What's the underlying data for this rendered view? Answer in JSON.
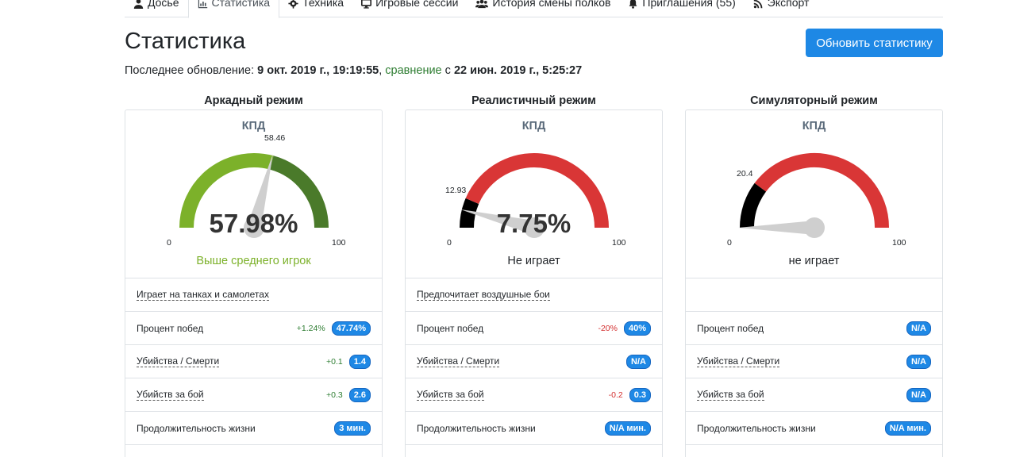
{
  "tabs": [
    {
      "label": "Досье",
      "icon": "user-icon",
      "active": false
    },
    {
      "label": "Статистика",
      "icon": "chart-icon",
      "active": true
    },
    {
      "label": "Техника",
      "icon": "gear-icon",
      "active": false
    },
    {
      "label": "Игровые сессии",
      "icon": "monitor-icon",
      "active": false
    },
    {
      "label": "История смены полков",
      "icon": "users-icon",
      "active": false
    },
    {
      "label": "Приглашения (55)",
      "icon": "bell-icon",
      "active": false
    },
    {
      "label": "Экспорт",
      "icon": "rss-icon",
      "active": false
    }
  ],
  "header": {
    "title": "Статистика",
    "refresh_label": "Обновить статистику"
  },
  "update": {
    "prefix": "Последнее обновление: ",
    "date": "9 окт. 2019 г., 19:19:55",
    "comma": ", ",
    "compare": "сравнение",
    "with": " с ",
    "compare_date": "22 июн. 2019 г., 5:25:27"
  },
  "colors": {
    "accent": "#1e88e5",
    "gauge_green_light": "#7cb12a",
    "gauge_green_dark": "#4a7a2a",
    "gauge_red": "#d93636",
    "gauge_black": "#000000",
    "positive": "#2e7d32",
    "negative": "#d32f2f"
  },
  "modes": [
    {
      "title": "Аркадный режим",
      "kpd_label": "КПД",
      "gauge": {
        "min_label": "0",
        "max_label": "100",
        "marker_label": "58.46",
        "marker": 58.46,
        "value": 57.98,
        "value_label": "57.98%",
        "fill_color": "#7cb12a",
        "rest_color": "#4a7a2a"
      },
      "status": "Выше среднего игрок",
      "status_color": "#7cb12a",
      "preference": "Играет на танках и самолетах",
      "rows": [
        {
          "label": "Процент побед",
          "dotted": false,
          "delta": "+1.24%",
          "delta_sign": "pos",
          "value": "47.74%"
        },
        {
          "label": "Убийства / Смерти",
          "dotted": true,
          "delta": "+0.1",
          "delta_sign": "pos",
          "value": "1.4"
        },
        {
          "label": "Убийств за бой",
          "dotted": true,
          "delta": "+0.3",
          "delta_sign": "pos",
          "value": "2.6"
        },
        {
          "label": "Продолжительность жизни",
          "dotted": false,
          "delta": "",
          "delta_sign": "",
          "value": "3 мин."
        }
      ]
    },
    {
      "title": "Реалистичный режим",
      "kpd_label": "КПД",
      "gauge": {
        "min_label": "0",
        "max_label": "100",
        "marker_label": "12.93",
        "marker": 12.93,
        "value": 7.75,
        "value_label": "7.75%",
        "fill_color": "#000000",
        "rest_color": "#d93636"
      },
      "status": "Не играет",
      "status_color": "#212529",
      "preference": "Предпочитает воздушные бои",
      "rows": [
        {
          "label": "Процент побед",
          "dotted": false,
          "delta": "-20%",
          "delta_sign": "neg",
          "value": "40%"
        },
        {
          "label": "Убийства / Смерти",
          "dotted": true,
          "delta": "",
          "delta_sign": "",
          "value": "N/A"
        },
        {
          "label": "Убийств за бой",
          "dotted": true,
          "delta": "-0.2",
          "delta_sign": "neg",
          "value": "0.3"
        },
        {
          "label": "Продолжительность жизни",
          "dotted": false,
          "delta": "",
          "delta_sign": "",
          "value": "N/A мин."
        }
      ]
    },
    {
      "title": "Симуляторный режим",
      "kpd_label": "КПД",
      "gauge": {
        "min_label": "0",
        "max_label": "100",
        "marker_label": "20.4",
        "marker": 20.4,
        "value": 0,
        "value_label": "",
        "fill_color": "#000000",
        "rest_color": "#d93636"
      },
      "status": "не играет",
      "status_color": "#212529",
      "preference": "",
      "rows": [
        {
          "label": "Процент побед",
          "dotted": false,
          "delta": "",
          "delta_sign": "",
          "value": "N/A"
        },
        {
          "label": "Убийства / Смерти",
          "dotted": true,
          "delta": "",
          "delta_sign": "",
          "value": "N/A"
        },
        {
          "label": "Убийств за бой",
          "dotted": true,
          "delta": "",
          "delta_sign": "",
          "value": "N/A"
        },
        {
          "label": "Продолжительность жизни",
          "dotted": false,
          "delta": "",
          "delta_sign": "",
          "value": "N/A мин."
        }
      ]
    }
  ]
}
